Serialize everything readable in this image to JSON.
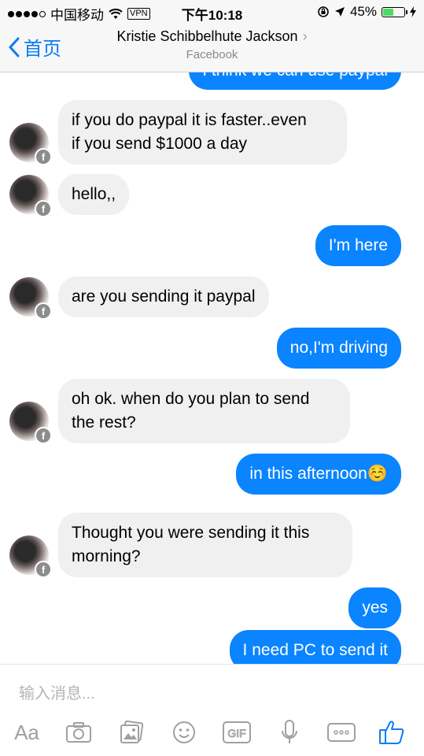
{
  "status_bar": {
    "carrier": "中国移动",
    "vpn": "VPN",
    "time": "下午10:18",
    "battery": "45%",
    "battery_level": 0.45
  },
  "nav": {
    "back_label": "首页",
    "title": "Kristie Schibbelhute Jackson",
    "subtitle": "Facebook"
  },
  "messages": [
    {
      "from": "me",
      "text": "I think we can use paypal"
    },
    {
      "from": "them",
      "lines": [
        "if you do paypal it is faster..even",
        "if you send $1000 a day"
      ]
    },
    {
      "from": "them",
      "lines": [
        "hello,,"
      ]
    },
    {
      "from": "me",
      "text": "I'm here"
    },
    {
      "from": "them",
      "lines": [
        "are you sending it paypal"
      ]
    },
    {
      "from": "me",
      "text": "no,I'm driving"
    },
    {
      "from": "them",
      "lines": [
        "oh ok. when do you plan to send",
        "the rest?"
      ]
    },
    {
      "from": "me",
      "text": "in this afternoon☺️"
    },
    {
      "from": "them",
      "lines": [
        "Thought you were sending it this",
        "morning?"
      ]
    },
    {
      "from": "me",
      "text": "yes"
    },
    {
      "from": "me",
      "text": "I need PC to send it"
    }
  ],
  "avatar_badge": "f",
  "composer": {
    "placeholder": "输入消息...",
    "aa_label": "Aa",
    "gif_label": "GIF",
    "icons": [
      "text-format-icon",
      "camera-icon",
      "photo-icon",
      "emoji-icon",
      "gif-icon",
      "microphone-icon",
      "more-icon",
      "like-icon"
    ]
  },
  "colors": {
    "accent": "#0a84ff",
    "incoming_bubble": "#f1f0f0",
    "icon_gray": "#a0a0a0",
    "like_blue": "#0a7cf5"
  }
}
